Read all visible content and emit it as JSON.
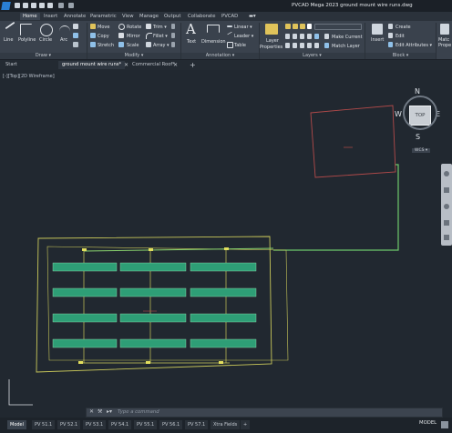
{
  "title_bar": {
    "text": "PVCAD Mega 2023  ground mount wire runs.dwg"
  },
  "ribbon_tabs": [
    "Home",
    "Insert",
    "Annotate",
    "Parametric",
    "View",
    "Manage",
    "Output",
    "Collaborate",
    "PVCAD"
  ],
  "active_ribbon_tab": "Home",
  "ribbon": {
    "draw": {
      "line": "Line",
      "polyline": "Polyline",
      "circle": "Circle",
      "arc": "Arc",
      "panel_label": "Draw ▾"
    },
    "modify": {
      "move": "Move",
      "rotate": "Rotate",
      "trim": "Trim ▾",
      "copy": "Copy",
      "mirror": "Mirror",
      "fillet": "Fillet ▾",
      "stretch": "Stretch",
      "scale": "Scale",
      "array": "Array ▾",
      "panel_label": "Modify ▾"
    },
    "annotation": {
      "text": "Text",
      "dimension": "Dimension",
      "linear": "Linear ▾",
      "leader": "Leader ▾",
      "table": "Table",
      "panel_label": "Annotation ▾"
    },
    "layers": {
      "layer_properties_1": "Layer",
      "layer_properties_2": "Properties",
      "make_current": "Make Current",
      "match_layer": "Match Layer",
      "panel_label": "Layers ▾"
    },
    "block": {
      "insert": "Insert",
      "create": "Create",
      "edit": "Edit",
      "edit_attributes": "Edit Attributes ▾",
      "panel_label": "Block ▾"
    },
    "extra": {
      "label": "Matc Prope"
    }
  },
  "doc_tabs": [
    "Start",
    "ground mount wire runs*",
    "Commercial Roof*"
  ],
  "active_doc_tab": "ground mount wire runs*",
  "view_label": "[-][Top][2D Wireframe]",
  "viewcube": {
    "north": "N",
    "south": "S",
    "east": "E",
    "west": "W",
    "face": "TOP",
    "wcs": "WCS ▾"
  },
  "command_line": {
    "placeholder": "Type a command"
  },
  "layout_tabs": [
    "Model",
    "PV 51.1",
    "PV 52.1",
    "PV 53.1",
    "PV 54.1",
    "PV 55.1",
    "PV 56.1",
    "PV 57.1",
    "Xtra Fields",
    "+"
  ],
  "active_layout_tab": "Model",
  "status": {
    "model": "MODEL"
  },
  "colors": {
    "background": "#212830",
    "boundary": "#c9c85a",
    "wire": "#6ec96b",
    "array": "#2e9e76",
    "roof_outline": "#b24a4a"
  }
}
